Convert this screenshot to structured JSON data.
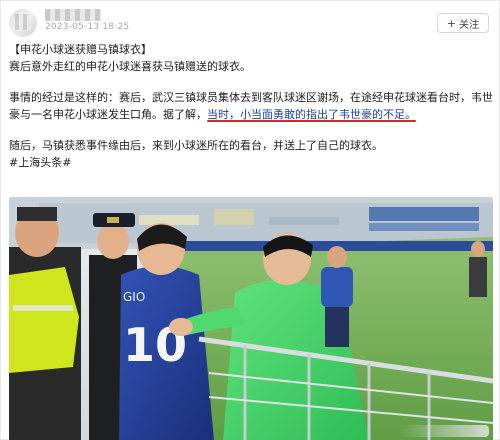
{
  "post": {
    "timestamp": "2023-05-13 18:25",
    "follow_label": "关注",
    "title_line": "【申花小球迷获赠马镇球衣】",
    "intro": "赛后意外走红的申花小球迷喜获马镇赠送的球衣。",
    "para2_before": "事情的经过是这样的：赛后，武汉三镇球员集体去到客队球迷区谢场，在途经申花球迷看台时，韦世豪与一名申花小球迷发生口角。据了解，",
    "para2_highlight": "当时，小当面勇敢的指出了韦世豪的不足。",
    "para3": "随后，马镇获悉事件缘由后，来到小球迷所在的看台，并送上了自己的球衣。",
    "tag": "#上海头条#",
    "jersey_name": "GIO",
    "jersey_number": "10"
  },
  "colors": {
    "highlight_underline": "#d8262d",
    "highlight_text": "#1d3f9a"
  },
  "icons": {
    "follow": "plus-icon"
  }
}
